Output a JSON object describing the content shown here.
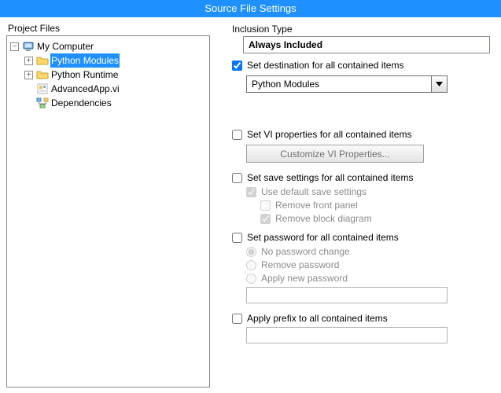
{
  "title": "Source File Settings",
  "left": {
    "header": "Project Files",
    "root": "My Computer",
    "items": [
      {
        "label": "Python Modules",
        "selected": true,
        "expandable": true
      },
      {
        "label": "Python Runtime",
        "selected": false,
        "expandable": true
      },
      {
        "label": "AdvancedApp.vi",
        "selected": false,
        "expandable": false
      },
      {
        "label": "Dependencies",
        "selected": false,
        "expandable": false
      }
    ]
  },
  "right": {
    "inclusion_label": "Inclusion Type",
    "inclusion_value": "Always Included",
    "set_destination_label": "Set destination for all contained items",
    "set_destination_checked": true,
    "destination_value": "Python Modules",
    "set_vi_props_label": "Set VI properties for all contained items",
    "customize_btn": "Customize VI Properties...",
    "set_save_label": "Set save settings for all contained items",
    "use_default_save": "Use default save settings",
    "remove_front_panel": "Remove front panel",
    "remove_block_diagram": "Remove block diagram",
    "set_password_label": "Set password for all contained items",
    "no_pw_change": "No password change",
    "remove_pw": "Remove password",
    "apply_new_pw": "Apply new password",
    "apply_prefix_label": "Apply prefix to all contained items"
  }
}
